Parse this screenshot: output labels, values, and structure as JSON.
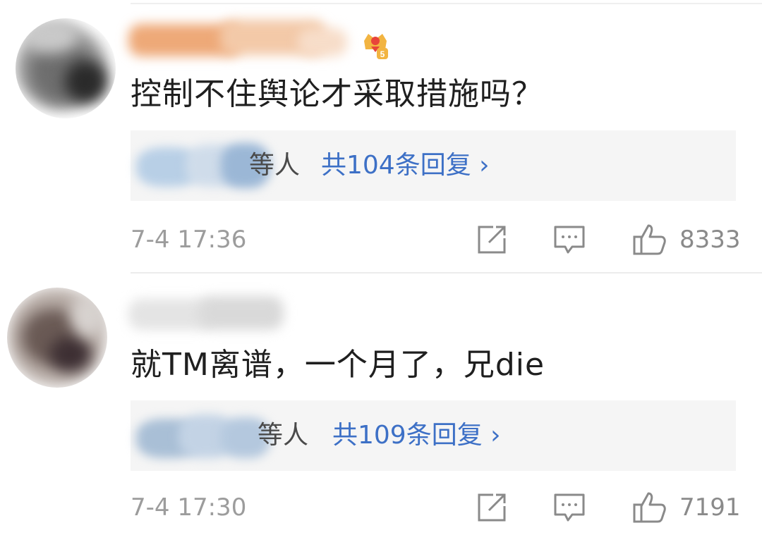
{
  "comments": [
    {
      "text": "控制不住舆论才采取措施吗？",
      "reply_suffix": "等人",
      "reply_link": "共104条回复 ›",
      "timestamp": "7-4 17:36",
      "likes": "8333",
      "badge_icon": "vip-crown-badge-icon",
      "avatar_blurred": true,
      "username_blurred": true
    },
    {
      "text": "就TM离谱，一个月了，兄die",
      "reply_suffix": "等人",
      "reply_link": "共109条回复 ›",
      "timestamp": "7-4 17:30",
      "likes": "7191",
      "avatar_blurred": true,
      "username_blurred": true
    }
  ],
  "colors": {
    "link": "#3d70c6",
    "meta_text": "#9c9c9c",
    "reply_box_bg": "#f5f5f5"
  },
  "icons": [
    "share-icon",
    "comment-icon",
    "like-icon"
  ]
}
